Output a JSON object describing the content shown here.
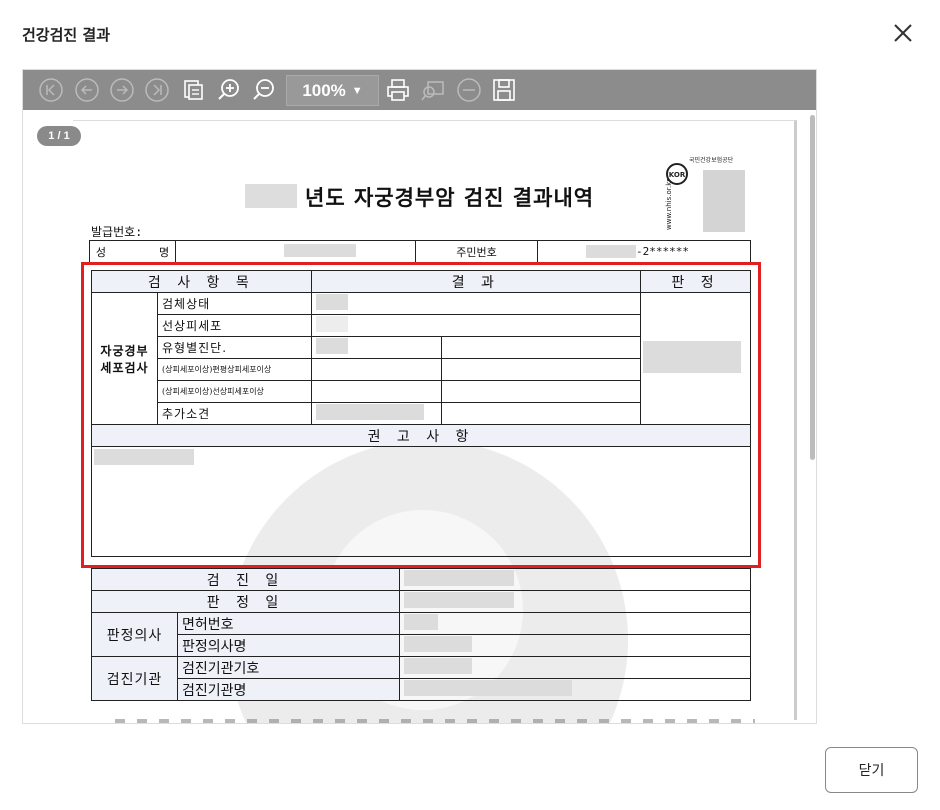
{
  "dialog": {
    "title": "건강검진 결과",
    "close_button_label": "닫기"
  },
  "viewer": {
    "zoom": "100%",
    "page_indicator": "1 / 1",
    "toolbar_icons": [
      "first-page-icon",
      "prev-page-icon",
      "next-page-icon",
      "last-page-icon",
      "export-icon",
      "zoom-in-icon",
      "zoom-out-icon",
      "print-icon",
      "print-preview-icon",
      "minus-icon",
      "save-icon"
    ]
  },
  "document": {
    "title": "년도 자궁경부암 검진 결과내역",
    "issue_no_label": "발급번호:",
    "name_label": "성        명",
    "resident_no_label": "주민번호",
    "resident_no_value": "-2******",
    "logo_url_text": "www.nhis.or.kr",
    "logo_org_text": "국민건강보험공단",
    "logo_mark": "KOR",
    "exam": {
      "header_item": "검 사 항 목",
      "header_result": "결     과",
      "header_judgment": "판   정",
      "group_label_line1": "자궁경부",
      "group_label_line2": "세포검사",
      "rows": [
        "검체상태",
        "선상피세포",
        "유형별진단.",
        "(상피세포이상)편평상피세포이상",
        "(상피세포이상)선상피세포이상",
        "추가소견"
      ],
      "recommendation_header": "권 고 사 항"
    },
    "info": {
      "exam_date": "검   진   일",
      "judgment_date": "판   정   일",
      "doctor": "판정의사",
      "license_no": "면허번호",
      "doctor_name": "판정의사명",
      "institution": "검진기관",
      "institution_code": "검진기관기호",
      "institution_name": "검진기관명"
    }
  },
  "colors": {
    "highlight": "#e02020",
    "toolbar": "#8c8c8c",
    "table_header": "#eef1f8"
  }
}
